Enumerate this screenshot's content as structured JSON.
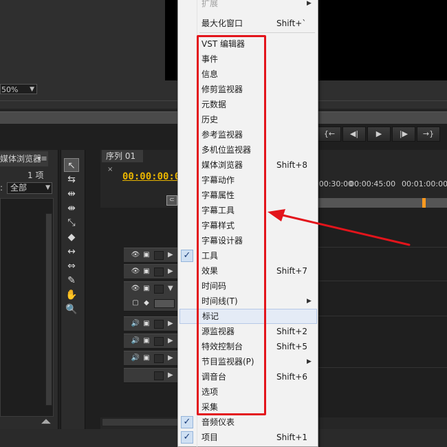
{
  "monitor": {
    "zoom": "50%"
  },
  "transport": {
    "buttons": [
      {
        "name": "step-back-in-button",
        "glyph": "{←"
      },
      {
        "name": "step-back-button",
        "glyph": "◀|"
      },
      {
        "name": "play-button",
        "glyph": "▶"
      },
      {
        "name": "step-forward-button",
        "glyph": "|▶"
      },
      {
        "name": "go-to-out-button",
        "glyph": "→}"
      }
    ]
  },
  "media_browser": {
    "tab_label": "媒体浏览器",
    "item_count": "1 项",
    "filter_value": "全部"
  },
  "sequence": {
    "tab_label": "序列 01",
    "timecode": "00:00:00:00",
    "ruler_times": [
      "00:00:30:00",
      "00:00:45:00",
      "00:01:00:00"
    ]
  },
  "tools": [
    {
      "name": "selection-tool-icon",
      "glyph": "↖"
    },
    {
      "name": "track-select-tool-icon",
      "glyph": "⇆"
    },
    {
      "name": "ripple-edit-tool-icon",
      "glyph": "⇹"
    },
    {
      "name": "rolling-edit-tool-icon",
      "glyph": "⇼"
    },
    {
      "name": "rate-stretch-tool-icon",
      "glyph": "⤡"
    },
    {
      "name": "razor-tool-icon",
      "glyph": "◆"
    },
    {
      "name": "slip-tool-icon",
      "glyph": "↔"
    },
    {
      "name": "slide-tool-icon",
      "glyph": "⇔"
    },
    {
      "name": "pen-tool-icon",
      "glyph": "✎"
    },
    {
      "name": "hand-tool-icon",
      "glyph": "✋"
    },
    {
      "name": "zoom-tool-icon",
      "glyph": "🔍"
    }
  ],
  "menu": {
    "items": [
      {
        "label": "扩展",
        "shortcut": "",
        "submenu": true,
        "checked": false,
        "disabled": true
      },
      {
        "label": "最大化窗口",
        "shortcut": "Shift+`",
        "submenu": false,
        "checked": false
      },
      {
        "label": "VST 编辑器",
        "shortcut": "",
        "submenu": false,
        "checked": false
      },
      {
        "label": "事件",
        "shortcut": "",
        "submenu": false,
        "checked": false
      },
      {
        "label": "信息",
        "shortcut": "",
        "submenu": false,
        "checked": false
      },
      {
        "label": "修剪监视器",
        "shortcut": "",
        "submenu": false,
        "checked": false
      },
      {
        "label": "元数据",
        "shortcut": "",
        "submenu": false,
        "checked": false
      },
      {
        "label": "历史",
        "shortcut": "",
        "submenu": false,
        "checked": false
      },
      {
        "label": "参考监视器",
        "shortcut": "",
        "submenu": false,
        "checked": false
      },
      {
        "label": "多机位监视器",
        "shortcut": "",
        "submenu": false,
        "checked": false
      },
      {
        "label": "媒体浏览器",
        "shortcut": "Shift+8",
        "submenu": false,
        "checked": false
      },
      {
        "label": "字幕动作",
        "shortcut": "",
        "submenu": false,
        "checked": false
      },
      {
        "label": "字幕属性",
        "shortcut": "",
        "submenu": false,
        "checked": false
      },
      {
        "label": "字幕工具",
        "shortcut": "",
        "submenu": false,
        "checked": false
      },
      {
        "label": "字幕样式",
        "shortcut": "",
        "submenu": false,
        "checked": false
      },
      {
        "label": "字幕设计器",
        "shortcut": "",
        "submenu": false,
        "checked": false
      },
      {
        "label": "工具",
        "shortcut": "",
        "submenu": false,
        "checked": true
      },
      {
        "label": "效果",
        "shortcut": "Shift+7",
        "submenu": false,
        "checked": false
      },
      {
        "label": "时间码",
        "shortcut": "",
        "submenu": false,
        "checked": false
      },
      {
        "label": "时间线(T)",
        "shortcut": "",
        "submenu": true,
        "checked": false
      },
      {
        "label": "标记",
        "shortcut": "",
        "submenu": false,
        "checked": false,
        "hovered": true
      },
      {
        "label": "源监视器",
        "shortcut": "Shift+2",
        "submenu": false,
        "checked": false
      },
      {
        "label": "特效控制台",
        "shortcut": "Shift+5",
        "submenu": false,
        "checked": false
      },
      {
        "label": "节目监视器(P)",
        "shortcut": "",
        "submenu": true,
        "checked": false
      },
      {
        "label": "调音台",
        "shortcut": "Shift+6",
        "submenu": false,
        "checked": false
      },
      {
        "label": "选项",
        "shortcut": "",
        "submenu": false,
        "checked": false
      },
      {
        "label": "采集",
        "shortcut": "",
        "submenu": false,
        "checked": false
      },
      {
        "label": "音频仪表",
        "shortcut": "",
        "submenu": false,
        "checked": true
      },
      {
        "label": "项目",
        "shortcut": "Shift+1",
        "submenu": false,
        "checked": true
      }
    ]
  },
  "colors": {
    "annotation": "#e3141b",
    "timecode": "#e8b400",
    "menu_bg": "#f2f2f2"
  }
}
